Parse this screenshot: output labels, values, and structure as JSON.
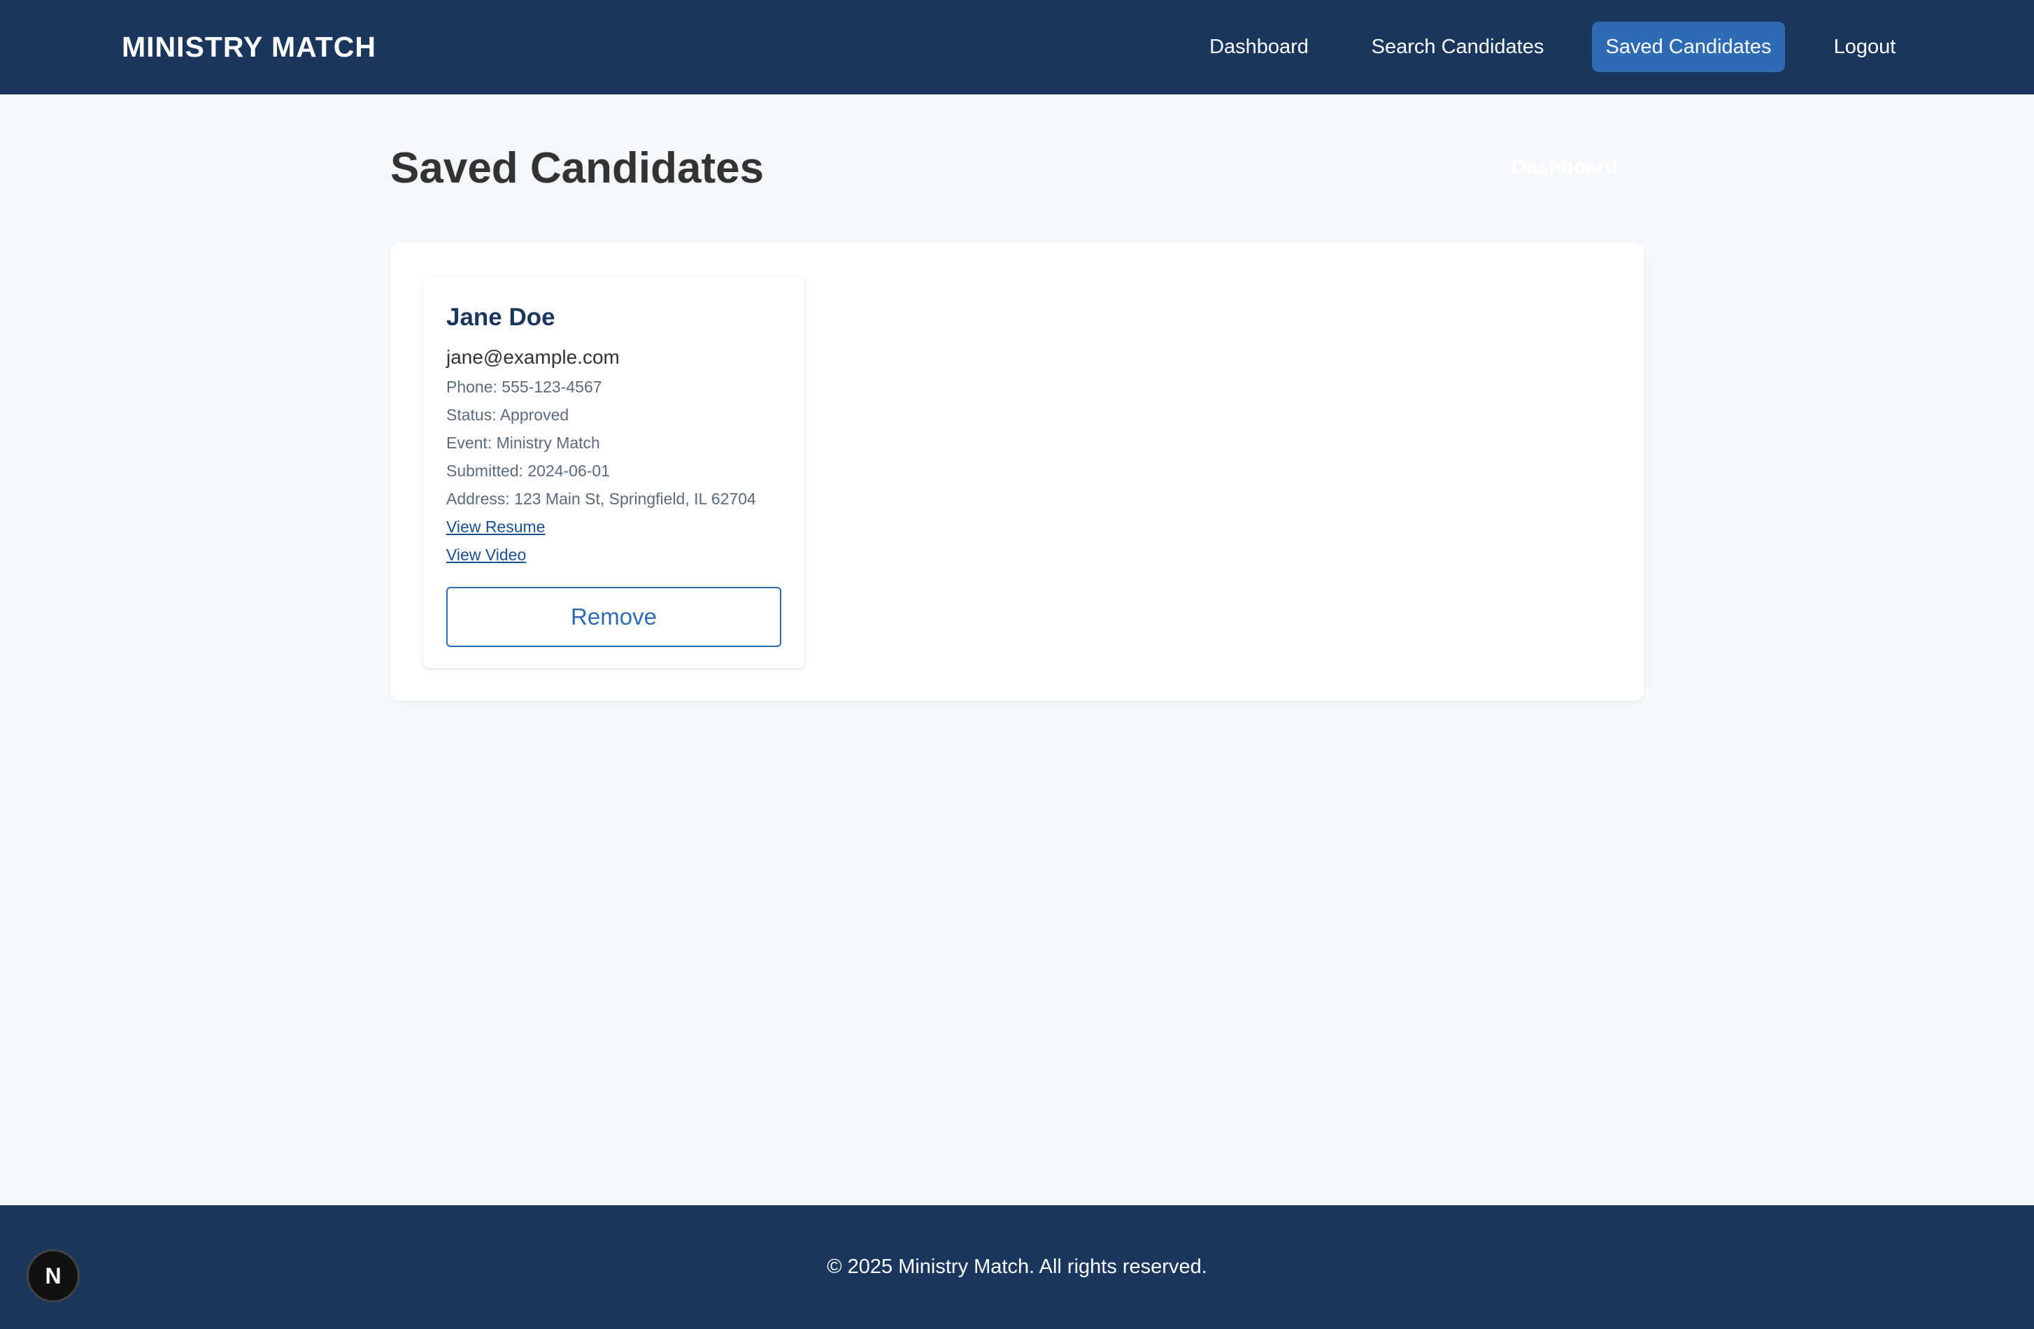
{
  "navbar": {
    "brand": "MINISTRY MATCH",
    "links": [
      {
        "label": "Dashboard"
      },
      {
        "label": "Search Candidates"
      },
      {
        "label": "Saved Candidates",
        "active": true
      },
      {
        "label": "Logout"
      }
    ]
  },
  "page": {
    "title": "Saved Candidates",
    "header_link": "Dashboard"
  },
  "candidates": [
    {
      "name": "Jane Doe",
      "email": "jane@example.com",
      "phone": "Phone: 555-123-4567",
      "status": "Status: Approved",
      "event": "Event: Ministry Match",
      "submitted": "Submitted: 2024-06-01",
      "address": "Address: 123 Main St, Springfield, IL 62704",
      "resume_link": "View Resume",
      "video_link": "View Video",
      "remove_label": "Remove"
    }
  ],
  "footer": {
    "text": "© 2025 Ministry Match. All rights reserved."
  },
  "badge": {
    "letter": "N"
  },
  "colors": {
    "navy": "#1b365d",
    "accent": "#2d6cb5",
    "background": "#f4f8fb"
  }
}
